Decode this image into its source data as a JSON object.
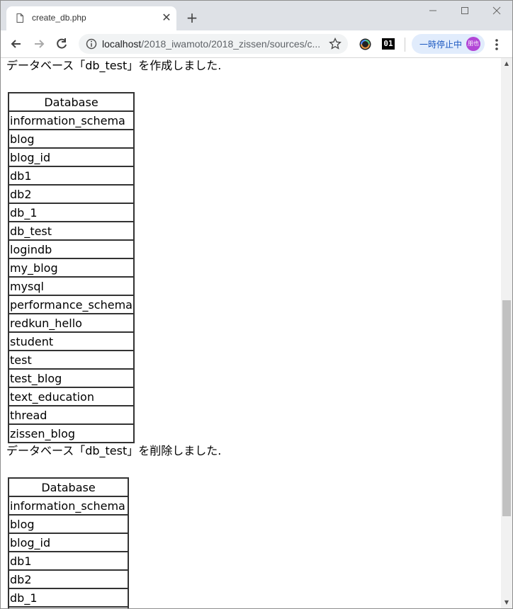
{
  "browser": {
    "tab_title": "create_db.php",
    "url_host": "localhost",
    "url_path": "/2018_iwamoto/2018_zissen/sources/c...",
    "profile_label": "一時停止中",
    "avatar_text": "朋也",
    "ext2_label": "01"
  },
  "sections": [
    {
      "message": "データベース「db_test」を作成しました.",
      "header": "Database",
      "rows": [
        "information_schema",
        "blog",
        "blog_id",
        "db1",
        "db2",
        "db_1",
        "db_test",
        "logindb",
        "my_blog",
        "mysql",
        "performance_schema",
        "redkun_hello",
        "student",
        "test",
        "test_blog",
        "text_education",
        "thread",
        "zissen_blog"
      ]
    },
    {
      "message": "データベース「db_test」を削除しました.",
      "header": "Database",
      "rows": [
        "information_schema",
        "blog",
        "blog_id",
        "db1",
        "db2",
        "db_1",
        ""
      ]
    }
  ],
  "colors": {
    "tabstrip": "#dee1e6",
    "omnibox": "#f1f3f4",
    "profile_bg": "#e1ecfc",
    "profile_text": "#1a57c0",
    "avatar": "#b246d6"
  }
}
